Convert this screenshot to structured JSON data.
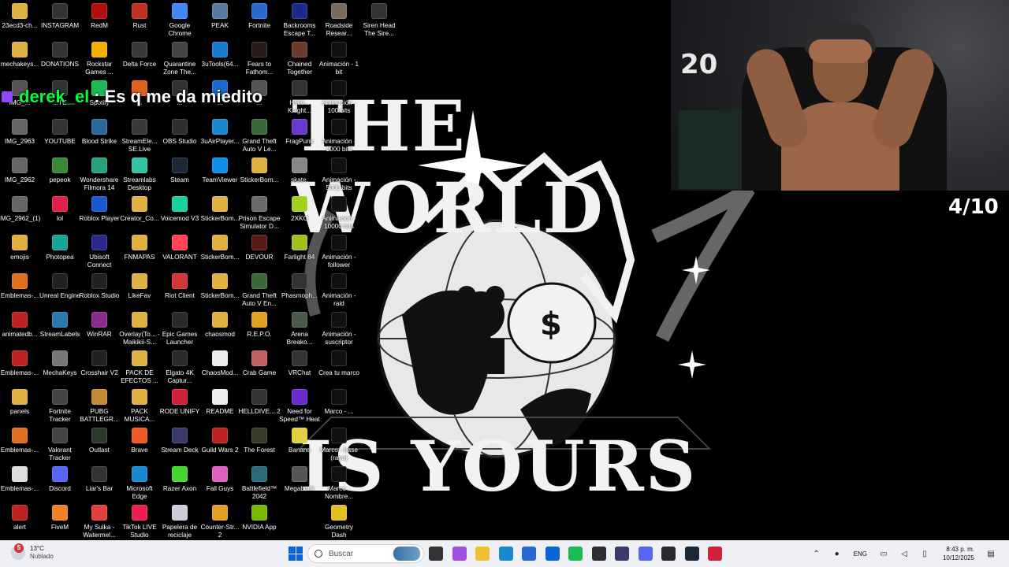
{
  "wallpaper": {
    "line1": "THE WORLD",
    "line2": "IS YOURS"
  },
  "chat": {
    "username": "derek_el",
    "message": "Es q me da miedito"
  },
  "webcam": {
    "jersey_number": "20"
  },
  "counter": "4/10",
  "desktop_icons": [
    {
      "label": "23ecd3-ch...",
      "color": "#e0b040"
    },
    {
      "label": "mechakeys...",
      "color": "#e0b040"
    },
    {
      "label": "IMG_...",
      "color": "#555"
    },
    {
      "label": "IMG_2963",
      "color": "#666"
    },
    {
      "label": "IMG_2962",
      "color": "#666"
    },
    {
      "label": "IMG_2962_(1)",
      "color": "#666"
    },
    {
      "label": "emojis",
      "color": "#e0b040"
    },
    {
      "label": "Emblemas-...",
      "color": "#e07020"
    },
    {
      "label": "animatedb...",
      "color": "#c02020"
    },
    {
      "label": "Emblemas-...",
      "color": "#c02020"
    },
    {
      "label": "panels",
      "color": "#e0b040"
    },
    {
      "label": "Emblemas-...",
      "color": "#e07020"
    },
    {
      "label": "Emblemas-...",
      "color": "#ddd"
    },
    {
      "label": "alert",
      "color": "#c02020"
    },
    {
      "label": "INSTAGRAM",
      "color": "#333"
    },
    {
      "label": "DONATIONS",
      "color": "#333"
    },
    {
      "label": "...TE",
      "color": "#333"
    },
    {
      "label": "YOUTUBE",
      "color": "#333"
    },
    {
      "label": "pepeok",
      "color": "#3a8a3a"
    },
    {
      "label": "lol",
      "color": "#e0204a"
    },
    {
      "label": "Photopea",
      "color": "#18a497"
    },
    {
      "label": "Unreal Engine",
      "color": "#222"
    },
    {
      "label": "StreamLabels",
      "color": "#2a7ab0"
    },
    {
      "label": "MechaKeys",
      "color": "#777"
    },
    {
      "label": "Fortnite Tracker",
      "color": "#444"
    },
    {
      "label": "Valorant Tracker",
      "color": "#444"
    },
    {
      "label": "Discord",
      "color": "#5865f2"
    },
    {
      "label": "FiveM",
      "color": "#f08020"
    },
    {
      "label": "RedM",
      "color": "#b01010"
    },
    {
      "label": "Rockstar Games ...",
      "color": "#f0b000"
    },
    {
      "label": "Spotify",
      "color": "#1db954"
    },
    {
      "label": "Blood Strike",
      "color": "#2a6a9a"
    },
    {
      "label": "Wondershare Filmora 14",
      "color": "#2aa080"
    },
    {
      "label": "Roblox Player",
      "color": "#1a5ad0"
    },
    {
      "label": "Ubisoft Connect",
      "color": "#2a2a8a"
    },
    {
      "label": "Roblox Studio",
      "color": "#222"
    },
    {
      "label": "WinRAR",
      "color": "#8a2a8a"
    },
    {
      "label": "Crosshair V2",
      "color": "#222"
    },
    {
      "label": "PUBG BATTLEGR...",
      "color": "#c08a30"
    },
    {
      "label": "Outlast",
      "color": "#2a3a2a"
    },
    {
      "label": "Liar's Bar",
      "color": "#333"
    },
    {
      "label": "My Suika - Watermel...",
      "color": "#e04040"
    },
    {
      "label": "Rust",
      "color": "#c03020"
    },
    {
      "label": "Delta Force",
      "color": "#3a3a3a"
    },
    {
      "label": "...",
      "color": "#e06020"
    },
    {
      "label": "StreamEle... SE.Live",
      "color": "#3a3a3a"
    },
    {
      "label": "Streamlabs Desktop",
      "color": "#31c3a2"
    },
    {
      "label": "Creator_Co...",
      "color": "#e0b040"
    },
    {
      "label": "FNMAPAS",
      "color": "#e0b040"
    },
    {
      "label": "LikeFav",
      "color": "#e0b040"
    },
    {
      "label": "Overlay(To... - Maikikii-S...",
      "color": "#e0b040"
    },
    {
      "label": "PACK DE EFECTOS ...",
      "color": "#e0b040"
    },
    {
      "label": "PACK MUSICA...",
      "color": "#e0b040"
    },
    {
      "label": "Brave",
      "color": "#f05a24"
    },
    {
      "label": "Microsoft Edge",
      "color": "#1a8ad0"
    },
    {
      "label": "TikTok LIVE Studio",
      "color": "#ee1d52"
    },
    {
      "label": "Google Chrome",
      "color": "#4285f4"
    },
    {
      "label": "Quarantine Zone The...",
      "color": "#444"
    },
    {
      "label": "...",
      "color": "#333"
    },
    {
      "label": "OBS Studio",
      "color": "#302e31"
    },
    {
      "label": "Steam",
      "color": "#1b2838"
    },
    {
      "label": "Voicemod V3",
      "color": "#1ad0a0"
    },
    {
      "label": "VALORANT",
      "color": "#ff4655"
    },
    {
      "label": "Riot Client",
      "color": "#d13639"
    },
    {
      "label": "Epic Games Launcher",
      "color": "#2a2a2a"
    },
    {
      "label": "Elgato 4K Captur...",
      "color": "#2a2a2a"
    },
    {
      "label": "RODE UNIFY",
      "color": "#d0203a"
    },
    {
      "label": "Stream Deck",
      "color": "#3a3a6a"
    },
    {
      "label": "Razer Axon",
      "color": "#44d62c"
    },
    {
      "label": "Papelera de reciclaje",
      "color": "#ccd"
    },
    {
      "label": "PEAK",
      "color": "#5a7aa0"
    },
    {
      "label": "3uTools(64...",
      "color": "#1a7ad0"
    },
    {
      "label": "...",
      "color": "#1a6ad0"
    },
    {
      "label": "3uAirPlayer...",
      "color": "#1a8ad0"
    },
    {
      "label": "TeamViewer",
      "color": "#0e8ee9"
    },
    {
      "label": "StickerBom...",
      "color": "#e0b040"
    },
    {
      "label": "StickerBom...",
      "color": "#e0b040"
    },
    {
      "label": "StickerBom...",
      "color": "#e0b040"
    },
    {
      "label": "chaosmod",
      "color": "#e0b040"
    },
    {
      "label": "ChaosMod...",
      "color": "#eee"
    },
    {
      "label": "README",
      "color": "#eee"
    },
    {
      "label": "Guild Wars 2",
      "color": "#c02020"
    },
    {
      "label": "Fall Guys",
      "color": "#e060c0"
    },
    {
      "label": "Counter-Str... 2",
      "color": "#e0a020"
    },
    {
      "label": "Fortnite",
      "color": "#2a6ad0"
    },
    {
      "label": "Fears to Fathom...",
      "color": "#2a1a1a"
    },
    {
      "label": "...",
      "color": "#555"
    },
    {
      "label": "Grand Theft Auto V Le...",
      "color": "#3a6a3a"
    },
    {
      "label": "StickerBom...",
      "color": "#e0b040"
    },
    {
      "label": "Prison Escape Simulator D...",
      "color": "#6a6a6a"
    },
    {
      "label": "DEVOUR",
      "color": "#5a1a1a"
    },
    {
      "label": "Grand Theft Auto V En...",
      "color": "#3a6a3a"
    },
    {
      "label": "R.E.P.O.",
      "color": "#e0a020"
    },
    {
      "label": "Crab Game",
      "color": "#c06060"
    },
    {
      "label": "HELLDIVE... 2",
      "color": "#333"
    },
    {
      "label": "The Forest",
      "color": "#3a3a2a"
    },
    {
      "label": "Battlefield™ 2042",
      "color": "#2a6a7a"
    },
    {
      "label": "NVIDIA App",
      "color": "#76b900"
    },
    {
      "label": "Backrooms Escape T...",
      "color": "#1a2a8a"
    },
    {
      "label": "Chained Together",
      "color": "#6a3a2a"
    },
    {
      "label": "Hello... Knight...",
      "color": "#333"
    },
    {
      "label": "FragPunk",
      "color": "#6a3ad0"
    },
    {
      "label": "skate.",
      "color": "#888"
    },
    {
      "label": "2XKO",
      "color": "#a0d020"
    },
    {
      "label": "Farlight 84",
      "color": "#a0c020"
    },
    {
      "label": "Phasmoph...",
      "color": "#333"
    },
    {
      "label": "Arena Breako...",
      "color": "#4a5a4a"
    },
    {
      "label": "VRChat",
      "color": "#333"
    },
    {
      "label": "Need for Speed™ Heat",
      "color": "#6a2ad0"
    },
    {
      "label": "Banana",
      "color": "#e0d040"
    },
    {
      "label": "Megabonk",
      "color": "#555"
    },
    {
      "label": "Roadside Resear...",
      "color": "#7a6a5a"
    },
    {
      "label": "Animación - 1 bit",
      "color": "#111"
    },
    {
      "label": "Animación - 100 bits",
      "color": "#111"
    },
    {
      "label": "Animación - 1000 bits",
      "color": "#111"
    },
    {
      "label": "Animación - 5000 bits",
      "color": "#111"
    },
    {
      "label": "Animación - 10000 bits",
      "color": "#111"
    },
    {
      "label": "Animación - follower",
      "color": "#111"
    },
    {
      "label": "Animación - raid",
      "color": "#111"
    },
    {
      "label": "Animación - suscriptor",
      "color": "#111"
    },
    {
      "label": "Crea tu marco",
      "color": "#111"
    },
    {
      "label": "Marco - ...",
      "color": "#111"
    },
    {
      "label": "Marco - base (rayo)",
      "color": "#111"
    },
    {
      "label": "Marco - Nombre...",
      "color": "#111"
    },
    {
      "label": "Geometry Dash",
      "color": "#e0c020"
    },
    {
      "label": "Siren Head The Sire...",
      "color": "#333"
    }
  ],
  "taskbar": {
    "weather": {
      "temp": "13°C",
      "condition": "Nublado",
      "badge": "5"
    },
    "search_placeholder": "Buscar",
    "apps": [
      {
        "name": "task-view",
        "color": "#333"
      },
      {
        "name": "copilot",
        "color": "#a050e0"
      },
      {
        "name": "file-explorer",
        "color": "#f0c030"
      },
      {
        "name": "edge",
        "color": "#1a8ad0"
      },
      {
        "name": "store",
        "color": "#2a6ad0"
      },
      {
        "name": "outlook",
        "color": "#0a64d8"
      },
      {
        "name": "spotify",
        "color": "#1db954"
      },
      {
        "name": "obs",
        "color": "#302e31"
      },
      {
        "name": "streamdeck",
        "color": "#3a3a6a"
      },
      {
        "name": "discord",
        "color": "#5865f2"
      },
      {
        "name": "epic-games",
        "color": "#2a2a2a"
      },
      {
        "name": "steam",
        "color": "#1b2838"
      },
      {
        "name": "rode",
        "color": "#d0203a"
      }
    ],
    "tray": {
      "language": "ENG",
      "time": "8:43 p. m.",
      "date": "10/12/2025"
    }
  }
}
